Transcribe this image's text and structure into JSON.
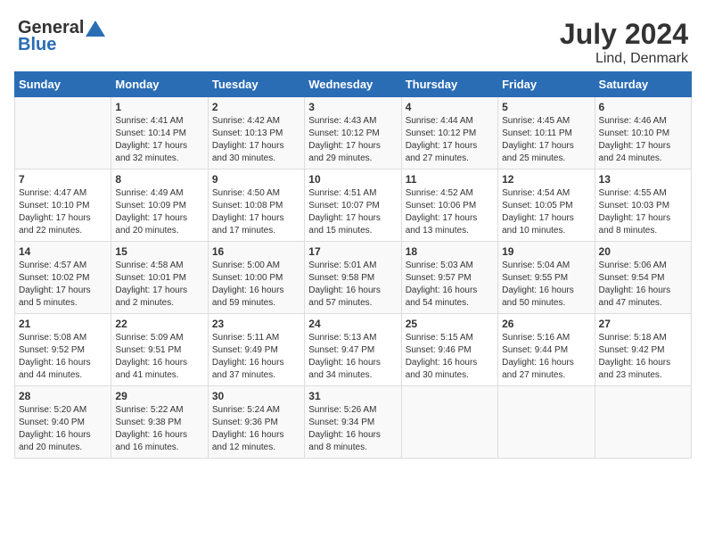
{
  "header": {
    "logo_general": "General",
    "logo_blue": "Blue",
    "month_title": "July 2024",
    "location": "Lind, Denmark"
  },
  "columns": [
    "Sunday",
    "Monday",
    "Tuesday",
    "Wednesday",
    "Thursday",
    "Friday",
    "Saturday"
  ],
  "weeks": [
    [
      {
        "day": "",
        "content": ""
      },
      {
        "day": "1",
        "content": "Sunrise: 4:41 AM\nSunset: 10:14 PM\nDaylight: 17 hours\nand 32 minutes."
      },
      {
        "day": "2",
        "content": "Sunrise: 4:42 AM\nSunset: 10:13 PM\nDaylight: 17 hours\nand 30 minutes."
      },
      {
        "day": "3",
        "content": "Sunrise: 4:43 AM\nSunset: 10:12 PM\nDaylight: 17 hours\nand 29 minutes."
      },
      {
        "day": "4",
        "content": "Sunrise: 4:44 AM\nSunset: 10:12 PM\nDaylight: 17 hours\nand 27 minutes."
      },
      {
        "day": "5",
        "content": "Sunrise: 4:45 AM\nSunset: 10:11 PM\nDaylight: 17 hours\nand 25 minutes."
      },
      {
        "day": "6",
        "content": "Sunrise: 4:46 AM\nSunset: 10:10 PM\nDaylight: 17 hours\nand 24 minutes."
      }
    ],
    [
      {
        "day": "7",
        "content": "Sunrise: 4:47 AM\nSunset: 10:10 PM\nDaylight: 17 hours\nand 22 minutes."
      },
      {
        "day": "8",
        "content": "Sunrise: 4:49 AM\nSunset: 10:09 PM\nDaylight: 17 hours\nand 20 minutes."
      },
      {
        "day": "9",
        "content": "Sunrise: 4:50 AM\nSunset: 10:08 PM\nDaylight: 17 hours\nand 17 minutes."
      },
      {
        "day": "10",
        "content": "Sunrise: 4:51 AM\nSunset: 10:07 PM\nDaylight: 17 hours\nand 15 minutes."
      },
      {
        "day": "11",
        "content": "Sunrise: 4:52 AM\nSunset: 10:06 PM\nDaylight: 17 hours\nand 13 minutes."
      },
      {
        "day": "12",
        "content": "Sunrise: 4:54 AM\nSunset: 10:05 PM\nDaylight: 17 hours\nand 10 minutes."
      },
      {
        "day": "13",
        "content": "Sunrise: 4:55 AM\nSunset: 10:03 PM\nDaylight: 17 hours\nand 8 minutes."
      }
    ],
    [
      {
        "day": "14",
        "content": "Sunrise: 4:57 AM\nSunset: 10:02 PM\nDaylight: 17 hours\nand 5 minutes."
      },
      {
        "day": "15",
        "content": "Sunrise: 4:58 AM\nSunset: 10:01 PM\nDaylight: 17 hours\nand 2 minutes."
      },
      {
        "day": "16",
        "content": "Sunrise: 5:00 AM\nSunset: 10:00 PM\nDaylight: 16 hours\nand 59 minutes."
      },
      {
        "day": "17",
        "content": "Sunrise: 5:01 AM\nSunset: 9:58 PM\nDaylight: 16 hours\nand 57 minutes."
      },
      {
        "day": "18",
        "content": "Sunrise: 5:03 AM\nSunset: 9:57 PM\nDaylight: 16 hours\nand 54 minutes."
      },
      {
        "day": "19",
        "content": "Sunrise: 5:04 AM\nSunset: 9:55 PM\nDaylight: 16 hours\nand 50 minutes."
      },
      {
        "day": "20",
        "content": "Sunrise: 5:06 AM\nSunset: 9:54 PM\nDaylight: 16 hours\nand 47 minutes."
      }
    ],
    [
      {
        "day": "21",
        "content": "Sunrise: 5:08 AM\nSunset: 9:52 PM\nDaylight: 16 hours\nand 44 minutes."
      },
      {
        "day": "22",
        "content": "Sunrise: 5:09 AM\nSunset: 9:51 PM\nDaylight: 16 hours\nand 41 minutes."
      },
      {
        "day": "23",
        "content": "Sunrise: 5:11 AM\nSunset: 9:49 PM\nDaylight: 16 hours\nand 37 minutes."
      },
      {
        "day": "24",
        "content": "Sunrise: 5:13 AM\nSunset: 9:47 PM\nDaylight: 16 hours\nand 34 minutes."
      },
      {
        "day": "25",
        "content": "Sunrise: 5:15 AM\nSunset: 9:46 PM\nDaylight: 16 hours\nand 30 minutes."
      },
      {
        "day": "26",
        "content": "Sunrise: 5:16 AM\nSunset: 9:44 PM\nDaylight: 16 hours\nand 27 minutes."
      },
      {
        "day": "27",
        "content": "Sunrise: 5:18 AM\nSunset: 9:42 PM\nDaylight: 16 hours\nand 23 minutes."
      }
    ],
    [
      {
        "day": "28",
        "content": "Sunrise: 5:20 AM\nSunset: 9:40 PM\nDaylight: 16 hours\nand 20 minutes."
      },
      {
        "day": "29",
        "content": "Sunrise: 5:22 AM\nSunset: 9:38 PM\nDaylight: 16 hours\nand 16 minutes."
      },
      {
        "day": "30",
        "content": "Sunrise: 5:24 AM\nSunset: 9:36 PM\nDaylight: 16 hours\nand 12 minutes."
      },
      {
        "day": "31",
        "content": "Sunrise: 5:26 AM\nSunset: 9:34 PM\nDaylight: 16 hours\nand 8 minutes."
      },
      {
        "day": "",
        "content": ""
      },
      {
        "day": "",
        "content": ""
      },
      {
        "day": "",
        "content": ""
      }
    ]
  ]
}
